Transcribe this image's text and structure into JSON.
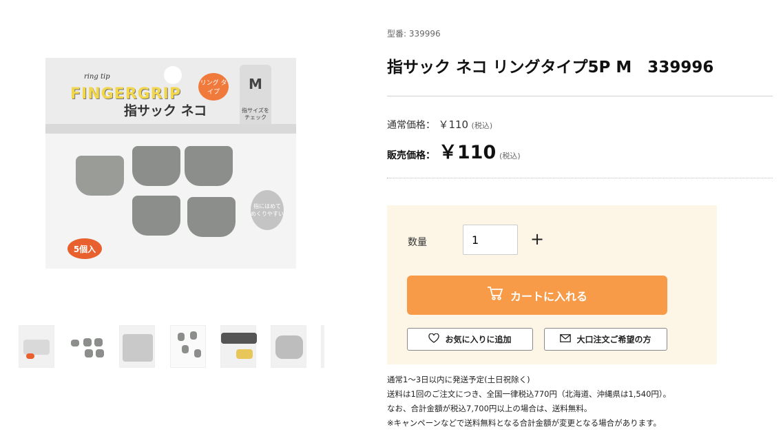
{
  "gallery": {
    "package": {
      "small_text": "ring tip",
      "brand": "FINGERGRIP",
      "name": "指サック ネコ",
      "bubble": "リング タイプ",
      "size_letter": "M",
      "size_note": "指サイズを チェック",
      "count_badge": "5個入",
      "ring_sticker": "指にはめて めくりやすい"
    },
    "thumbnails": [
      "thumb-1",
      "thumb-2",
      "thumb-3",
      "thumb-4",
      "thumb-5",
      "thumb-6",
      "thumb-7"
    ]
  },
  "product": {
    "model_label": "型番: 339996",
    "title": "指サック ネコ リングタイプ5P M　339996",
    "regular_price_label": "通常価格：",
    "regular_price": "￥110",
    "regular_tax": "(税込)",
    "sale_price_label": "販売価格：",
    "sale_price": "￥110",
    "sale_tax": "(税込)"
  },
  "buy": {
    "qty_label": "数量",
    "qty_value": "1",
    "plus": "+",
    "cart_label": "カートに入れる",
    "favorite_label": "お気に入りに追加",
    "bulk_label": "大口注文ご希望の方"
  },
  "shipping": {
    "line1": "通常1〜3日以内に発送予定(土日祝除く)",
    "line2": "送料は1回のご注文につき、全国一律税込770円（北海道、沖縄県は1,540円）。",
    "line3": "なお、合計金額が税込7,700円以上の場合は、送料無料。",
    "line4": "※キャンペーンなどで送料無料となる合計金額が変更となる場合があります。"
  },
  "colors": {
    "cart_button": "#f79b48",
    "buybox_bg": "#fdf6e6"
  }
}
